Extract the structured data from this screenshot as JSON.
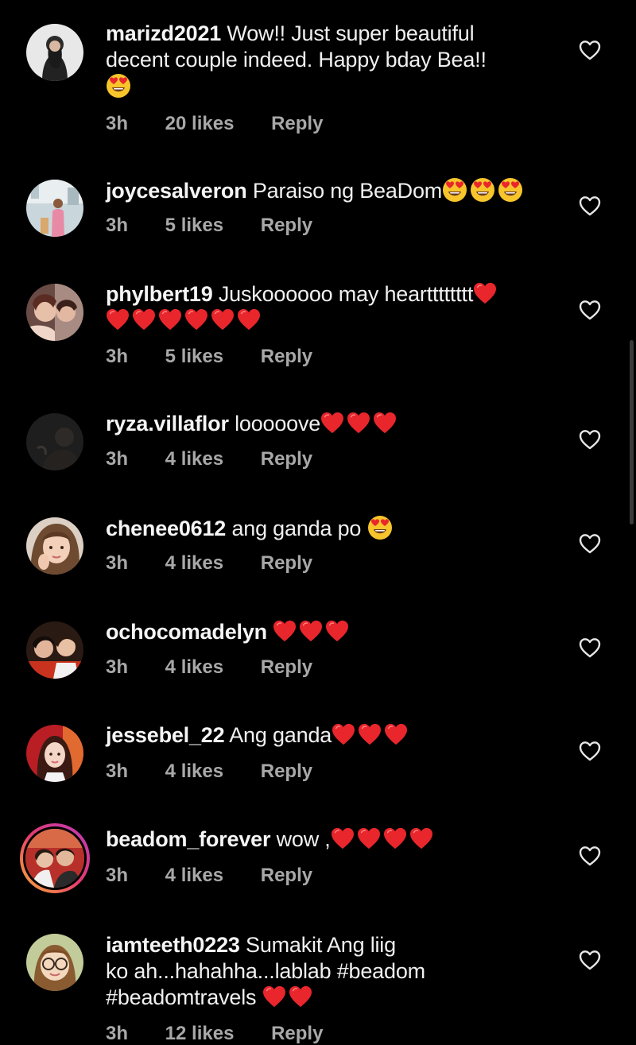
{
  "colors": {
    "background": "#000000",
    "text": "#f5f5f5",
    "meta": "#a8a8a8",
    "heart": "#e8262c",
    "emoji_face": "#f7c52b"
  },
  "comments": [
    {
      "username": "marizd2021",
      "text_lines": [
        "Wow!! Just super beautiful",
        "decent  couple  indeed. Happy bday Bea!!"
      ],
      "emojis": [
        "heart-eyes-emoji"
      ],
      "time": "3h",
      "likes": "20 likes",
      "reply": "Reply"
    },
    {
      "username": "joycesalveron",
      "text_lines": [
        "Paraiso ng BeaDom"
      ],
      "emojis": [
        "heart-eyes-emoji",
        "heart-eyes-emoji",
        "heart-eyes-emoji"
      ],
      "time": "3h",
      "likes": "5 likes",
      "reply": "Reply"
    },
    {
      "username": "phylbert19",
      "text_lines": [
        "Juskoooooo may heartttttttt"
      ],
      "emojis": [
        "red-heart-emoji",
        "red-heart-emoji",
        "red-heart-emoji",
        "red-heart-emoji",
        "red-heart-emoji",
        "red-heart-emoji",
        "red-heart-emoji"
      ],
      "time": "3h",
      "likes": "5 likes",
      "reply": "Reply"
    },
    {
      "username": "ryza.villaflor",
      "text_lines": [
        "looooove"
      ],
      "emojis": [
        "red-heart-emoji",
        "red-heart-emoji",
        "red-heart-emoji"
      ],
      "time": "3h",
      "likes": "4 likes",
      "reply": "Reply"
    },
    {
      "username": "chenee0612",
      "text_lines": [
        "ang ganda po"
      ],
      "emojis": [
        "heart-eyes-emoji"
      ],
      "time": "3h",
      "likes": "4 likes",
      "reply": "Reply"
    },
    {
      "username": "ochocomadelyn",
      "text_lines": [
        ""
      ],
      "emojis": [
        "red-heart-emoji",
        "red-heart-emoji",
        "red-heart-emoji"
      ],
      "time": "3h",
      "likes": "4 likes",
      "reply": "Reply"
    },
    {
      "username": "jessebel_22",
      "text_lines": [
        "Ang ganda"
      ],
      "emojis": [
        "red-heart-emoji",
        "red-heart-emoji",
        "red-heart-emoji"
      ],
      "time": "3h",
      "likes": "4 likes",
      "reply": "Reply"
    },
    {
      "username": "beadom_forever",
      "text_lines": [
        "wow ,"
      ],
      "emojis": [
        "red-heart-emoji",
        "red-heart-emoji",
        "red-heart-emoji",
        "red-heart-emoji"
      ],
      "time": "3h",
      "likes": "4 likes",
      "reply": "Reply"
    },
    {
      "username": "iamteeth0223",
      "text_lines": [
        "Sumakit Ang liig",
        "ko ah...hahahha...lablab #beadom",
        "#beadomtravels"
      ],
      "emojis": [
        "red-heart-emoji",
        "red-heart-emoji"
      ],
      "time": "3h",
      "likes": "12 likes",
      "reply": "Reply"
    }
  ],
  "like_icon": "heart-outline-icon"
}
